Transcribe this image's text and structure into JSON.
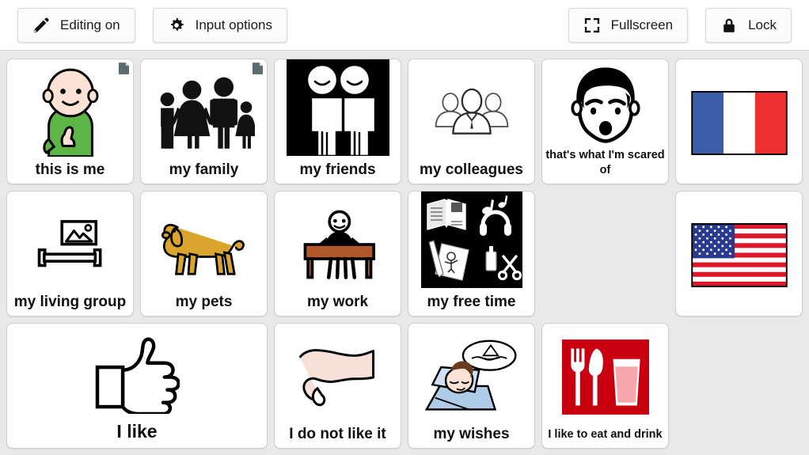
{
  "toolbar": {
    "left": [
      {
        "id": "editing",
        "label": "Editing on",
        "icon": "pencil-icon"
      },
      {
        "id": "input-options",
        "label": "Input options",
        "icon": "gear-icon"
      }
    ],
    "right": [
      {
        "id": "fullscreen",
        "label": "Fullscreen",
        "icon": "fullscreen-icon"
      },
      {
        "id": "lock",
        "label": "Lock",
        "icon": "lock-icon"
      }
    ]
  },
  "colors": {
    "page_background": "#e9e9e9",
    "toolbar_background": "#ffffff",
    "card_background": "#ffffff",
    "card_border": "#cfcfcf",
    "skin": "#fbe2d5",
    "shirt_green": "#5cb544",
    "dog_tan": "#d9a52c",
    "desk_brown": "#b0582a",
    "flag_fr_blue": "#3c5ea8",
    "flag_fr_red": "#ed3030",
    "flag_us_blue": "#2a3b8f",
    "flag_us_red": "#e0162b",
    "eat_drink_red": "#c8000f",
    "pictogram_black": "#000000",
    "badge_gray": "#5c6b72",
    "bed_blue": "#aecbe8",
    "hair_brown": "#6b3b1f"
  },
  "grid": {
    "columns": 6,
    "rows": 3,
    "cells": [
      {
        "id": "this-is-me",
        "label": "this is me",
        "row": 1,
        "col": 1,
        "span": 1,
        "art": "person-pointing-self",
        "badge": true,
        "cap": "normal"
      },
      {
        "id": "my-family",
        "label": "my family",
        "row": 1,
        "col": 2,
        "span": 1,
        "art": "family-silhouettes",
        "badge": true,
        "cap": "normal"
      },
      {
        "id": "my-friends",
        "label": "my friends",
        "row": 1,
        "col": 3,
        "span": 1,
        "art": "two-friends-inverted",
        "badge": false,
        "cap": "normal"
      },
      {
        "id": "my-colleagues",
        "label": "my colleagues",
        "row": 1,
        "col": 4,
        "span": 1,
        "art": "colleagues-group",
        "badge": false,
        "cap": "normal"
      },
      {
        "id": "scared-of",
        "label": "that's what I'm scared of",
        "row": 1,
        "col": 5,
        "span": 1,
        "art": "worried-face",
        "badge": false,
        "cap": "small"
      },
      {
        "id": "flag-france",
        "label": "",
        "row": 1,
        "col": 6,
        "span": 1,
        "art": "flag-france",
        "badge": false,
        "cap": "none"
      },
      {
        "id": "my-living-group",
        "label": "my living group",
        "row": 2,
        "col": 1,
        "span": 1,
        "art": "living-group-frame",
        "badge": false,
        "cap": "normal"
      },
      {
        "id": "my-pets",
        "label": "my pets",
        "row": 2,
        "col": 2,
        "span": 1,
        "art": "dog",
        "badge": false,
        "cap": "normal"
      },
      {
        "id": "my-work",
        "label": "my work",
        "row": 2,
        "col": 3,
        "span": 1,
        "art": "person-at-desk",
        "badge": false,
        "cap": "normal"
      },
      {
        "id": "my-free-time",
        "label": "my free time",
        "row": 2,
        "col": 4,
        "span": 1,
        "art": "free-time-inverted",
        "badge": false,
        "cap": "normal"
      },
      {
        "id": "empty-r2c5",
        "label": "",
        "row": 2,
        "col": 5,
        "span": 1,
        "art": "none",
        "badge": false,
        "cap": "none"
      },
      {
        "id": "flag-usa",
        "label": "",
        "row": 2,
        "col": 6,
        "span": 1,
        "art": "flag-usa",
        "badge": false,
        "cap": "none"
      },
      {
        "id": "i-like",
        "label": "I like",
        "row": 3,
        "col": 1,
        "span": 2,
        "art": "thumbs-up",
        "badge": false,
        "cap": "big"
      },
      {
        "id": "i-do-not-like-it",
        "label": "I do not like it",
        "row": 3,
        "col": 3,
        "span": 1,
        "art": "thumbs-down",
        "badge": false,
        "cap": "normal"
      },
      {
        "id": "my-wishes",
        "label": "my wishes",
        "row": 3,
        "col": 4,
        "span": 1,
        "art": "sleeping-dreaming",
        "badge": false,
        "cap": "normal"
      },
      {
        "id": "eat-and-drink",
        "label": "I like to eat and drink",
        "row": 3,
        "col": 5,
        "span": 1,
        "art": "cutlery-glass-red",
        "badge": false,
        "cap": "small"
      }
    ]
  }
}
